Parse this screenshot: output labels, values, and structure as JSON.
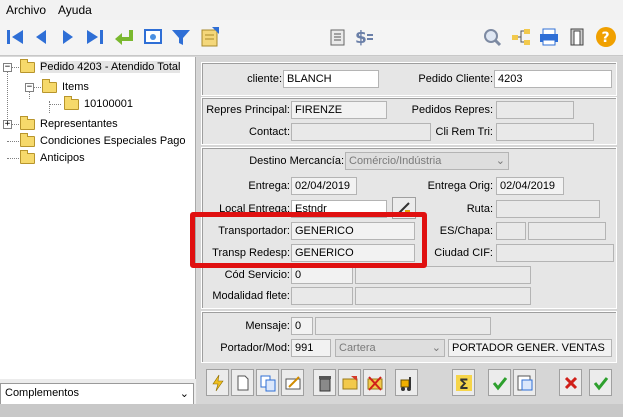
{
  "menu": {
    "file": "Archivo",
    "help": "Ayuda"
  },
  "toolbar_icons": [
    "first-icon",
    "prev-icon",
    "next-icon",
    "last-icon",
    "return-icon",
    "preview-icon",
    "filter-icon",
    "export-icon",
    "notes-icon",
    "currency-icon",
    "search-icon",
    "tree-icon",
    "print-icon",
    "exit-icon",
    "help-icon"
  ],
  "tree": {
    "root": "Pedido 4203 - Atendido Total",
    "items": "Items",
    "item_code": "10100001",
    "representantes": "Representantes",
    "condiciones": "Condiciones Especiales Pago",
    "anticipos": "Anticipos"
  },
  "left_combo": "Complementos",
  "header": {
    "cliente_label": "cliente:",
    "cliente_value": "BLANCH",
    "pedido_cliente_label": "Pedido Cliente:",
    "pedido_cliente_value": "4203"
  },
  "repres": {
    "principal_label": "Repres Principal:",
    "principal_value": "FIRENZE",
    "pedidos_label": "Pedidos Repres:",
    "pedidos_value": "",
    "contact_label": "Contact:",
    "contact_value": "",
    "cli_rem_label": "Cli Rem Tri:",
    "cli_rem_value": ""
  },
  "envio": {
    "destino_label": "Destino Mercancía:",
    "destino_value": "Comércio/Indústria",
    "entrega_label": "Entrega:",
    "entrega_value": "02/04/2019",
    "entrega_orig_label": "Entrega Orig:",
    "entrega_orig_value": "02/04/2019",
    "local_label": "Local Entrega:",
    "local_value": "Estndr",
    "ruta_label": "Ruta:",
    "ruta_value": "",
    "transportador_label": "Transportador:",
    "transportador_value": "GENERICO",
    "es_chapa_label": "ES/Chapa:",
    "transp_redesp_label": "Transp Redesp:",
    "transp_redesp_value": "GENERICO",
    "ciudad_cif_label": "Ciudad CIF:",
    "cod_servicio_label": "Cód Servicio:",
    "cod_servicio_value": "0",
    "modalidad_label": "Modalidad flete:",
    "modalidad_value": ""
  },
  "mensaje": {
    "mensaje_label": "Mensaje:",
    "mensaje_value": "0",
    "portador_label": "Portador/Mod:",
    "portador_code": "991",
    "portador_combo": "Cartera",
    "portador_name": "PORTADOR GENER. VENTAS"
  },
  "action_icons": [
    "lightning-icon",
    "new-document-icon",
    "copy-icon",
    "edit-icon",
    "delete-icon",
    "open-folder-icon",
    "cancel-folder-icon",
    "forklift-icon",
    "sum-icon",
    "confirm-icon",
    "report-icon",
    "close-icon",
    "accept-icon"
  ],
  "colors": {
    "highlight_border": "#e01010",
    "toolbar_blue": "#2f6fd6"
  }
}
